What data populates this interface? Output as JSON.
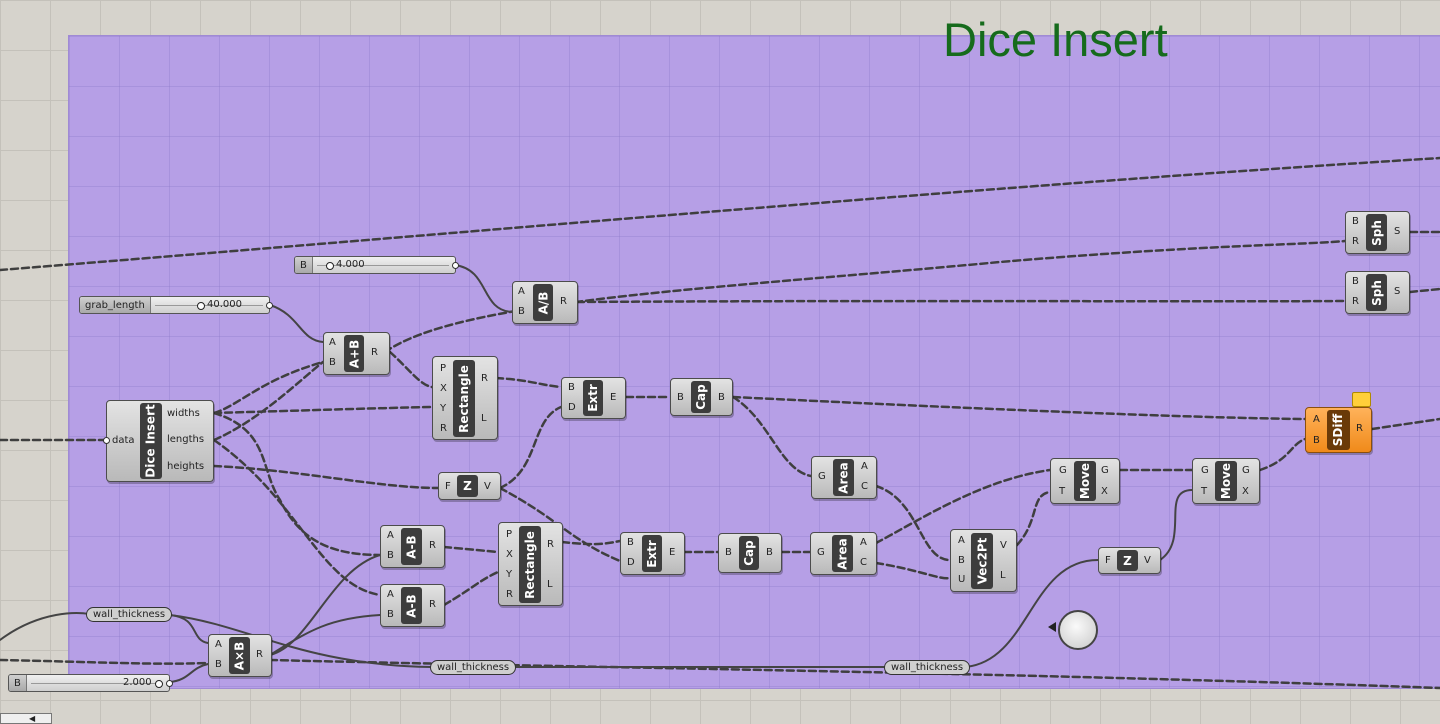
{
  "title": "Dice Insert",
  "colors": {
    "canvas": "#d6d3cc",
    "group": "#b69fe6",
    "title": "#166b1c",
    "component": "#cfcfcf",
    "highlight": "#f59a2a"
  },
  "sliders": {
    "grab_length": {
      "name": "grab_length",
      "value": "40.000"
    },
    "divisor": {
      "name": "B",
      "value": "4.000"
    },
    "thickness": {
      "name": "B",
      "value": "2.000"
    }
  },
  "relays": [
    "wall_thickness",
    "wall_thickness",
    "wall_thickness"
  ],
  "components": {
    "dice": {
      "name": "Dice Insert",
      "inputs": [
        "data"
      ],
      "outputs": [
        "widths",
        "lengths",
        "heights"
      ]
    },
    "add": {
      "name": "A+B",
      "inputs": [
        "A",
        "B"
      ],
      "outputs": [
        "R"
      ]
    },
    "div": {
      "name": "A/B",
      "inputs": [
        "A",
        "B"
      ],
      "outputs": [
        "R"
      ]
    },
    "rect1": {
      "name": "Rectangle",
      "inputs": [
        "P",
        "X",
        "Y",
        "R"
      ],
      "outputs": [
        "R",
        "L"
      ]
    },
    "extr1": {
      "name": "Extr",
      "inputs": [
        "B",
        "D"
      ],
      "outputs": [
        "E"
      ]
    },
    "cap1": {
      "name": "Cap",
      "inputs": [
        "B"
      ],
      "outputs": [
        "B"
      ]
    },
    "sph1": {
      "name": "Sph",
      "inputs": [
        "B",
        "R"
      ],
      "outputs": [
        "S"
      ]
    },
    "sph2": {
      "name": "Sph",
      "inputs": [
        "B",
        "R"
      ],
      "outputs": [
        "S"
      ]
    },
    "area1": {
      "name": "Area",
      "inputs": [
        "G"
      ],
      "outputs": [
        "A",
        "C"
      ]
    },
    "z1": {
      "name": "Z",
      "inputs": [
        "F"
      ],
      "outputs": [
        "V"
      ]
    },
    "sub1": {
      "name": "A-B",
      "inputs": [
        "A",
        "B"
      ],
      "outputs": [
        "R"
      ]
    },
    "sub2": {
      "name": "A-B",
      "inputs": [
        "A",
        "B"
      ],
      "outputs": [
        "R"
      ]
    },
    "mul": {
      "name": "A×B",
      "inputs": [
        "A",
        "B"
      ],
      "outputs": [
        "R"
      ]
    },
    "rect2": {
      "name": "Rectangle",
      "inputs": [
        "P",
        "X",
        "Y",
        "R"
      ],
      "outputs": [
        "R",
        "L"
      ]
    },
    "extr2": {
      "name": "Extr",
      "inputs": [
        "B",
        "D"
      ],
      "outputs": [
        "E"
      ]
    },
    "cap2": {
      "name": "Cap",
      "inputs": [
        "B"
      ],
      "outputs": [
        "B"
      ]
    },
    "area2": {
      "name": "Area",
      "inputs": [
        "G"
      ],
      "outputs": [
        "A",
        "C"
      ]
    },
    "vec2pt": {
      "name": "Vec2Pt",
      "inputs": [
        "A",
        "B",
        "U"
      ],
      "outputs": [
        "V",
        "L"
      ]
    },
    "move1": {
      "name": "Move",
      "inputs": [
        "G",
        "T"
      ],
      "outputs": [
        "G",
        "X"
      ]
    },
    "move2": {
      "name": "Move",
      "inputs": [
        "G",
        "T"
      ],
      "outputs": [
        "G",
        "X"
      ]
    },
    "z2": {
      "name": "Z",
      "inputs": [
        "F"
      ],
      "outputs": [
        "V"
      ]
    },
    "sdiff": {
      "name": "SDiff",
      "inputs": [
        "A",
        "B"
      ],
      "outputs": [
        "R"
      ]
    }
  }
}
